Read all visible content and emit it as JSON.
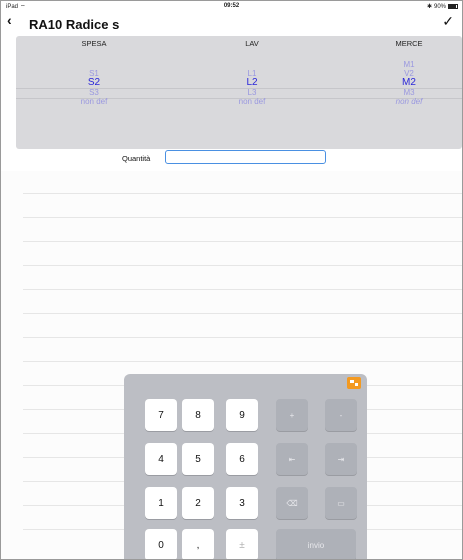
{
  "status": {
    "device": "iPad",
    "time": "09:52",
    "battery": "90%"
  },
  "nav": {
    "title": "RA10 Radice s"
  },
  "picker": {
    "columns": [
      {
        "header": "SPESA",
        "rows": [
          "S1",
          "S2",
          "S3",
          "non def"
        ],
        "selected": "S2"
      },
      {
        "header": "LAV",
        "rows": [
          "L1",
          "L2",
          "L3",
          "non def"
        ],
        "selected": "L2"
      },
      {
        "header": "MERCE",
        "rows": [
          "M1",
          "V2",
          "M2",
          "M3",
          "non def"
        ],
        "selected": "M2"
      }
    ]
  },
  "quantity": {
    "label": "Quantità",
    "value": ""
  },
  "keypad": {
    "keys": [
      "7",
      "8",
      "9",
      "+",
      "-",
      "4",
      "5",
      "6",
      "⇤",
      "⇥",
      "1",
      "2",
      "3",
      "⌫",
      "▭",
      "0",
      ",",
      "±",
      "invio"
    ]
  }
}
